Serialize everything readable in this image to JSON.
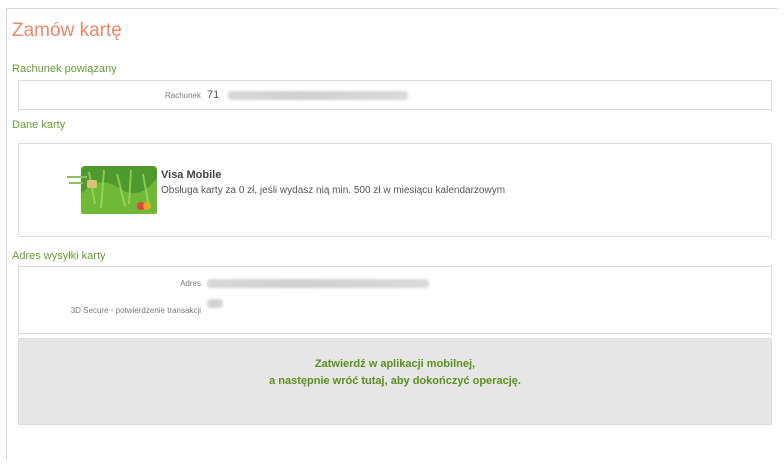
{
  "page": {
    "title": "Zamów kartę"
  },
  "linked_account": {
    "section_label": "Rachunek powiązany",
    "account_label": "Rachunek",
    "account_prefix": "71"
  },
  "card_data": {
    "section_label": "Dane karty",
    "card_name": "Visa Mobile",
    "card_description": "Obsługa karty za 0 zł, jeśli wydasz nią min. 500 zł w miesiącu kalendarzowym"
  },
  "shipping": {
    "section_label": "Adres wysyłki karty",
    "address_label": "Adres",
    "secure_label": "3D Secure - potwierdzenie transakcji"
  },
  "confirm": {
    "line1": "Zatwierdź w aplikacji mobilnej,",
    "line2": "a następnie wróć tutaj, aby dokończyć operację."
  }
}
